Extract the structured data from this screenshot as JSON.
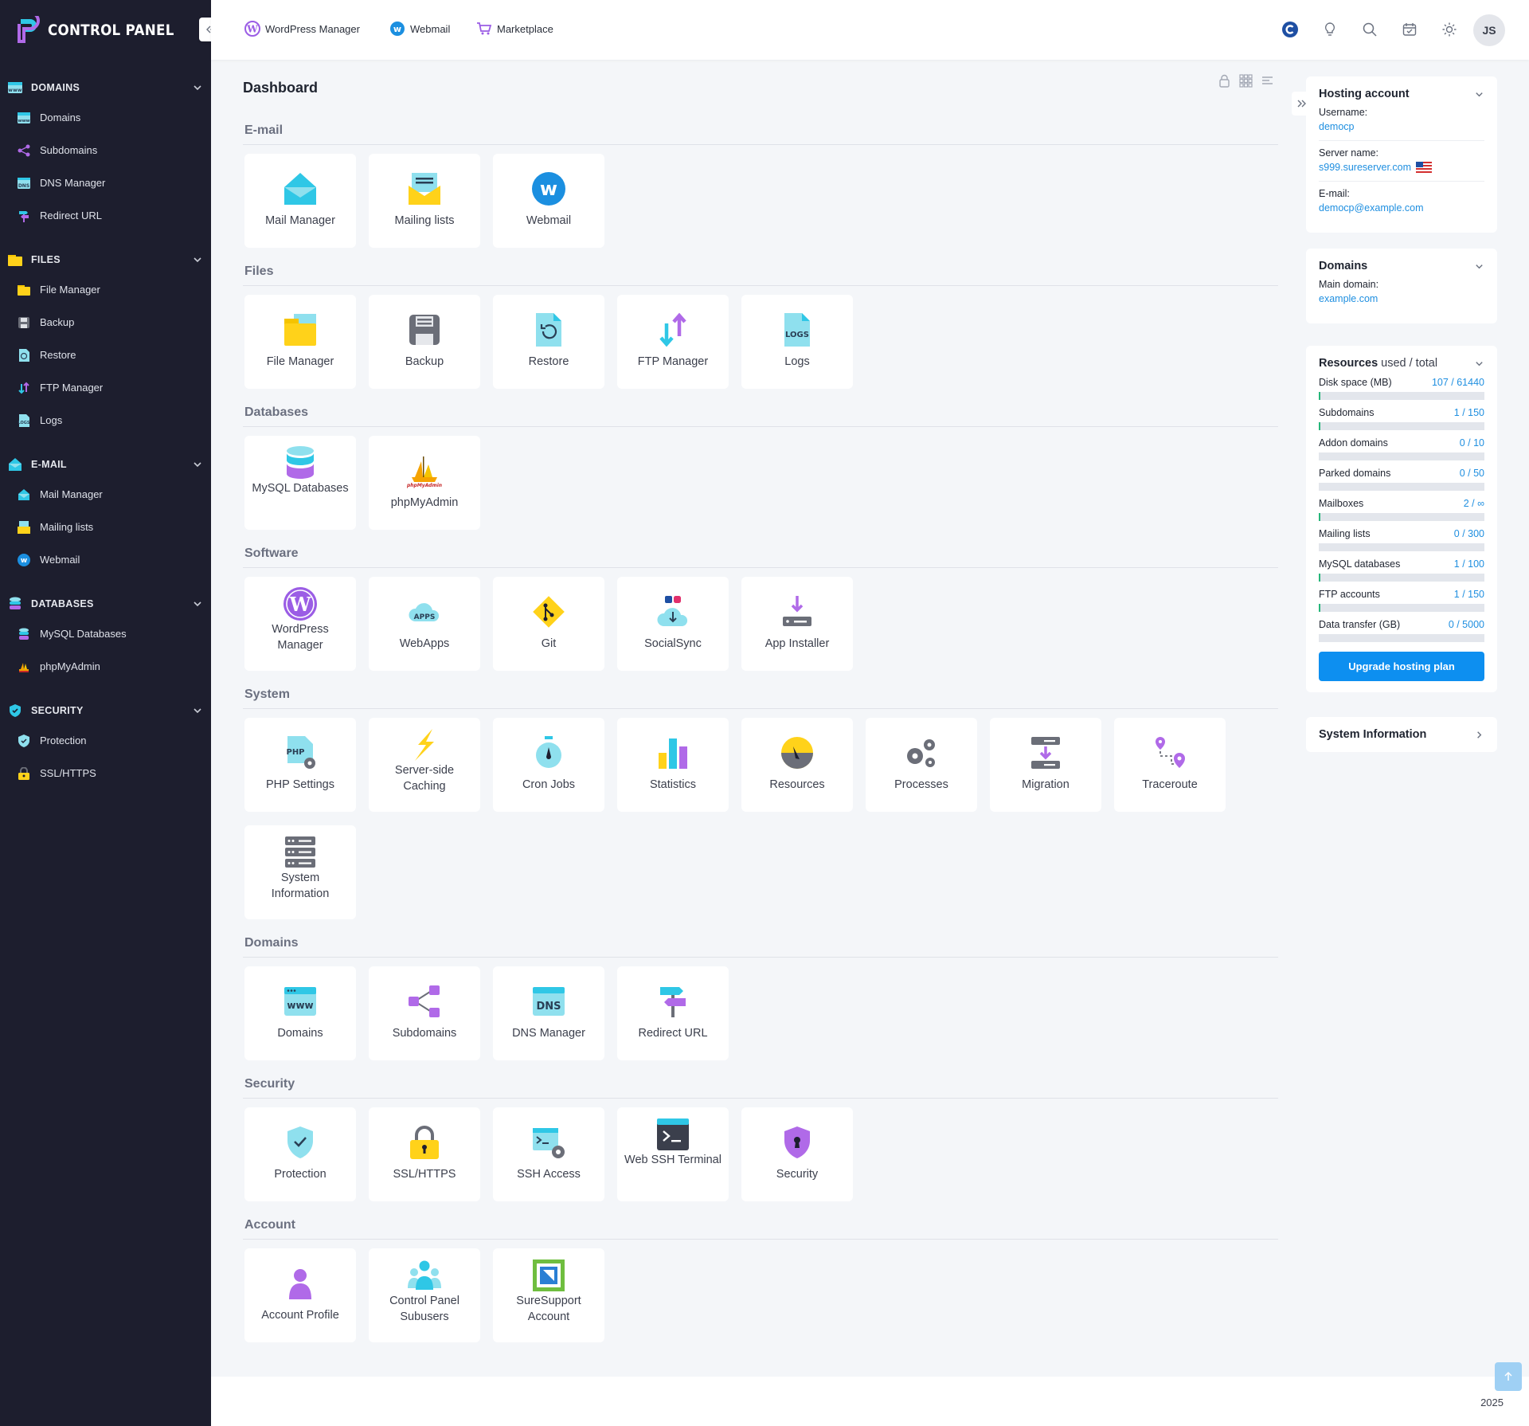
{
  "brand": {
    "title": "CONTROL PANEL"
  },
  "topbar": {
    "links": [
      "WordPress Manager",
      "Webmail",
      "Marketplace"
    ],
    "avatar_initials": "JS"
  },
  "sidebar": {
    "sections": [
      {
        "label": "DOMAINS",
        "items": [
          "Domains",
          "Subdomains",
          "DNS Manager",
          "Redirect URL"
        ]
      },
      {
        "label": "FILES",
        "items": [
          "File Manager",
          "Backup",
          "Restore",
          "FTP Manager",
          "Logs"
        ]
      },
      {
        "label": "E-MAIL",
        "items": [
          "Mail Manager",
          "Mailing lists",
          "Webmail"
        ]
      },
      {
        "label": "DATABASES",
        "items": [
          "MySQL Databases",
          "phpMyAdmin"
        ]
      },
      {
        "label": "SECURITY",
        "items": [
          "Protection",
          "SSL/HTTPS"
        ]
      }
    ]
  },
  "main": {
    "title": "Dashboard",
    "sections": [
      {
        "title": "E-mail",
        "tiles": [
          "Mail Manager",
          "Mailing lists",
          "Webmail"
        ]
      },
      {
        "title": "Files",
        "tiles": [
          "File Manager",
          "Backup",
          "Restore",
          "FTP Manager",
          "Logs"
        ]
      },
      {
        "title": "Databases",
        "tiles": [
          "MySQL Databases",
          "phpMyAdmin"
        ]
      },
      {
        "title": "Software",
        "tiles": [
          "WordPress Manager",
          "WebApps",
          "Git",
          "SocialSync",
          "App Installer"
        ]
      },
      {
        "title": "System",
        "tiles": [
          "PHP Settings",
          "Server-side Caching",
          "Cron Jobs",
          "Statistics",
          "Resources",
          "Processes",
          "Migration",
          "Traceroute",
          "System Information"
        ]
      },
      {
        "title": "Domains",
        "tiles": [
          "Domains",
          "Subdomains",
          "DNS Manager",
          "Redirect URL"
        ]
      },
      {
        "title": "Security",
        "tiles": [
          "Protection",
          "SSL/HTTPS",
          "SSH Access",
          "Web SSH Terminal",
          "Security"
        ]
      },
      {
        "title": "Account",
        "tiles": [
          "Account Profile",
          "Control Panel Subusers",
          "SureSupport Account"
        ]
      }
    ]
  },
  "hosting": {
    "title": "Hosting account",
    "username_label": "Username:",
    "username": "democp",
    "server_label": "Server name:",
    "server": "s999.sureserver.com",
    "email_label": "E-mail:",
    "email": "democp@example.com"
  },
  "domains_card": {
    "title": "Domains",
    "main_label": "Main domain:",
    "main": "example.com"
  },
  "resources": {
    "title": "Resources",
    "title_suffix": "used / total",
    "rows": [
      {
        "label": "Disk space (MB)",
        "value": "107 / 61440",
        "fraction": 0.002
      },
      {
        "label": "Subdomains",
        "value": "1 / 150",
        "fraction": 0.007
      },
      {
        "label": "Addon domains",
        "value": "0 / 10",
        "fraction": 0
      },
      {
        "label": "Parked domains",
        "value": "0 / 50",
        "fraction": 0
      },
      {
        "label": "Mailboxes",
        "value": "2 / ∞",
        "fraction": 0.01
      },
      {
        "label": "Mailing lists",
        "value": "0 / 300",
        "fraction": 0
      },
      {
        "label": "MySQL databases",
        "value": "1 / 100",
        "fraction": 0.01
      },
      {
        "label": "FTP accounts",
        "value": "1 / 150",
        "fraction": 0.007
      },
      {
        "label": "Data transfer (GB)",
        "value": "0 / 5000",
        "fraction": 0
      }
    ],
    "upgrade_label": "Upgrade hosting plan"
  },
  "sysinfo": {
    "title": "System Information"
  },
  "footer": {
    "year": "2025"
  },
  "colors": {
    "sidebar_bg": "#1d1e2e",
    "accent": "#0d8ff0",
    "link": "#1f8fe0"
  }
}
